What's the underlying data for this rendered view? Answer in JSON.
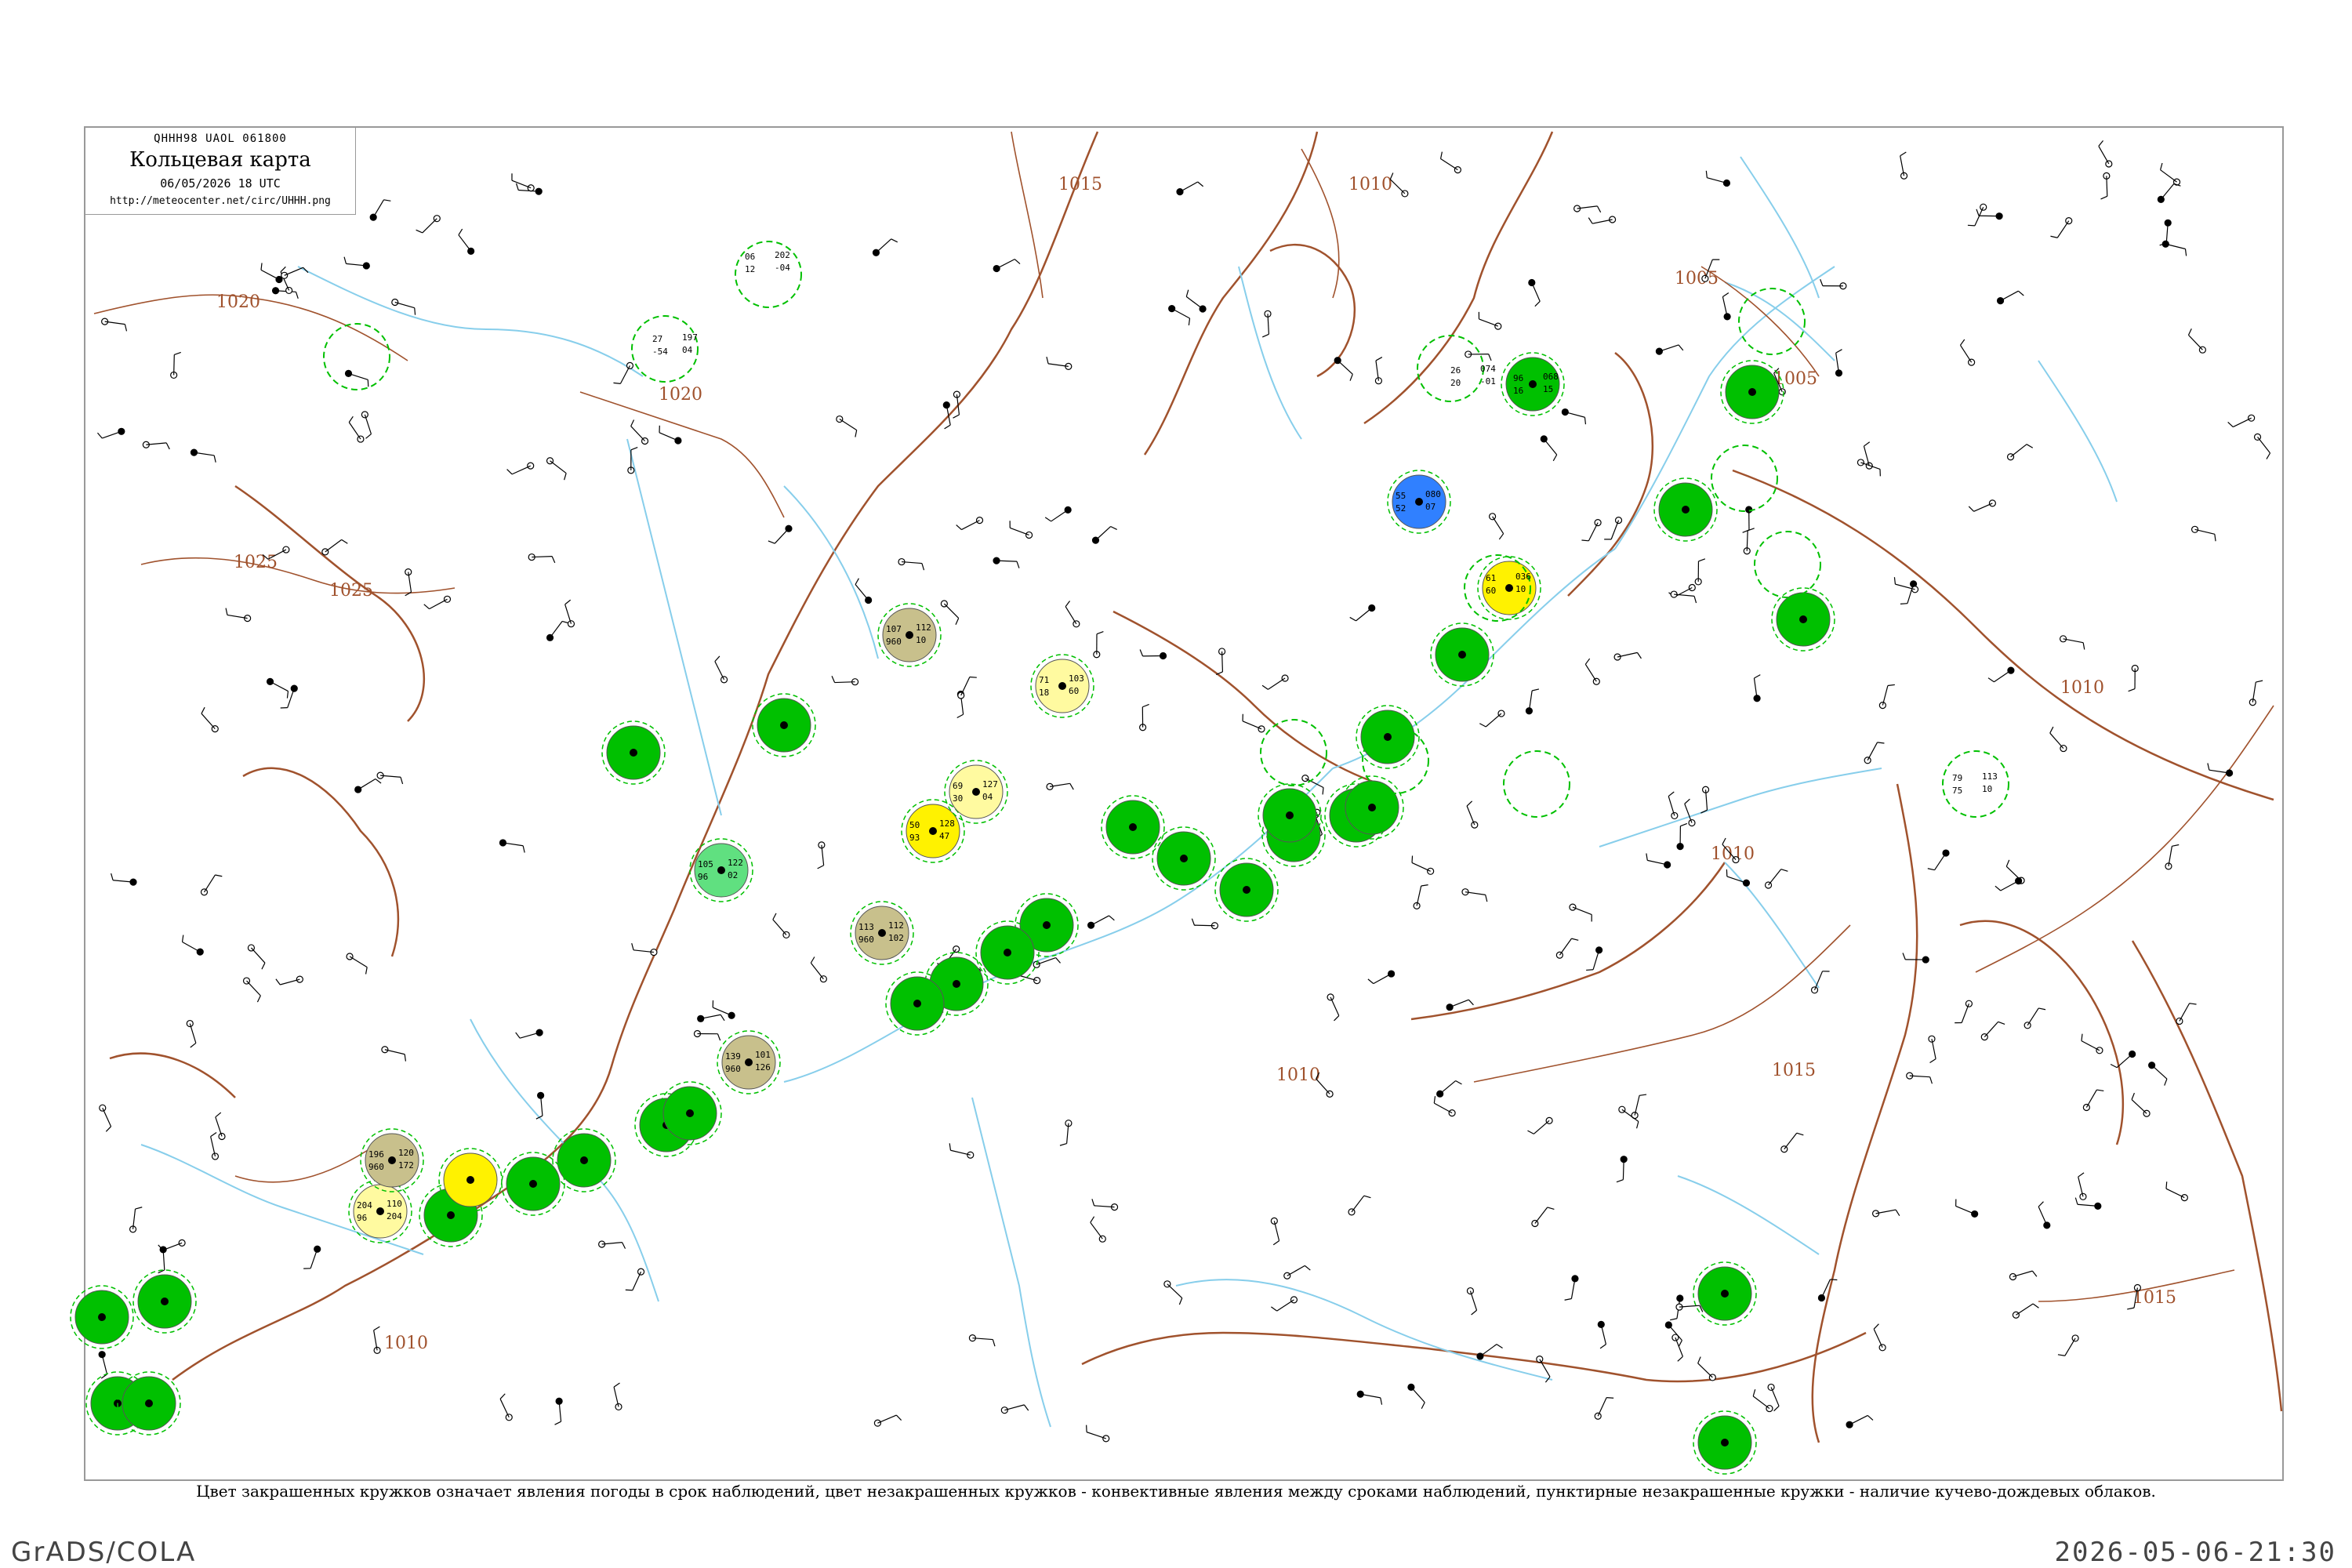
{
  "header": {
    "code": "QHHH98  UAOL  061800",
    "title": "Кольцевая карта",
    "date": "06/05/2026 18 UTC",
    "url": "http://meteocenter.net/circ/UHHH.png"
  },
  "legend_text": "Цвет закрашенных кружков означает явления погоды в срок наблюдений, цвет незакрашенных кружков - конвективные явления между сроками наблюдений, пунктирные незакрашенные кружки - наличие кучево-дождевых облаков.",
  "footer": {
    "left": "GrADS/COLA",
    "right": "2026-05-06-21:30"
  },
  "colors": {
    "isobar": "#a0522d",
    "river": "#87ceeb",
    "frame": "#999999",
    "rain_green": "#00c000",
    "snow_blue": "#3080ff",
    "fog_yellow": "#fff200",
    "haze_yellow": "#fffaa0",
    "dust_olive": "#c8c08c",
    "shower_mint": "#60e080"
  },
  "isobar_labels": [
    "1015",
    "1010",
    "1020",
    "1020",
    "1025",
    "1025",
    "1005",
    "1005",
    "1010",
    "1010",
    "1015",
    "1010",
    "1015",
    "1010"
  ],
  "stations": [
    {
      "p": "202",
      "t": "06",
      "d": "12",
      "tend": "-04"
    },
    {
      "p": "197",
      "t": "27",
      "d": "-54",
      "tend": "04"
    },
    {
      "p": "080",
      "t": "55",
      "d": "52",
      "tend": "07"
    },
    {
      "p": "074",
      "t": "26",
      "d": "20",
      "tend": "-01"
    },
    {
      "p": "068",
      "t": "96",
      "d": "16",
      "tend": "15"
    },
    {
      "p": "036",
      "t": "61",
      "d": "60",
      "tend": "10"
    },
    {
      "p": "103",
      "t": "71",
      "d": "18",
      "tend": "60"
    },
    {
      "p": "128",
      "t": "50",
      "d": "93",
      "tend": "47"
    },
    {
      "p": "127",
      "t": "69",
      "d": "30",
      "tend": "04"
    },
    {
      "p": "112",
      "t": "107",
      "d": "960",
      "tend": "10"
    },
    {
      "p": "112",
      "t": "113",
      "d": "960",
      "tend": "102"
    },
    {
      "p": "101",
      "t": "139",
      "d": "960",
      "tend": "126"
    },
    {
      "p": "120",
      "t": "196",
      "d": "960",
      "tend": "172"
    },
    {
      "p": "110",
      "t": "204",
      "d": "96",
      "tend": "204"
    },
    {
      "p": "122",
      "t": "105",
      "d": "96",
      "tend": "02"
    },
    {
      "p": "113",
      "t": "79",
      "d": "75",
      "tend": "10"
    }
  ]
}
